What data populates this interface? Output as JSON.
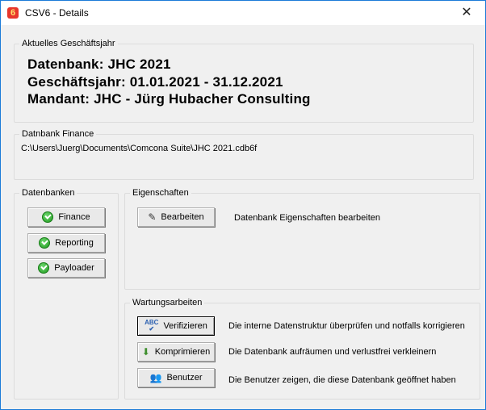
{
  "window": {
    "app_icon": "6",
    "title": "CSV6 - Details",
    "close_glyph": "✕"
  },
  "current_year": {
    "legend": "Aktuelles Geschäftsjahr",
    "database_line": "Datenbank: JHC 2021",
    "year_line": "Geschäftsjahr: 01.01.2021 - 31.12.2021",
    "client_line": "Mandant: JHC - Jürg Hubacher Consulting"
  },
  "finance_db": {
    "legend": "Datnbank Finance",
    "path": "C:\\Users\\Juerg\\Documents\\Comcona Suite\\JHC 2021.cdb6f"
  },
  "databases": {
    "legend": "Datenbanken",
    "buttons": [
      {
        "label": "Finance",
        "icon": "check-icon"
      },
      {
        "label": "Reporting",
        "icon": "check-icon"
      },
      {
        "label": "Payloader",
        "icon": "check-icon"
      }
    ]
  },
  "properties": {
    "legend": "Eigenschaften",
    "edit_button": {
      "label": "Bearbeiten",
      "icon": "edit-icon"
    },
    "edit_description": "Datenbank Eigenschaften bearbeiten"
  },
  "maintenance": {
    "legend": "Wartungsarbeiten",
    "verify_button": {
      "label": "Verifizieren",
      "icon": "spellcheck-icon"
    },
    "verify_description": "Die interne Datenstruktur überprüfen und notfalls korrigieren",
    "compress_button": {
      "label": "Komprimieren",
      "icon": "down-arrow-icon"
    },
    "compress_description": "Die Datenbank aufräumen und verlustfrei verkleinern",
    "users_button": {
      "label": "Benutzer",
      "icon": "users-icon"
    },
    "users_description": "Die Benutzer zeigen, die diese Datenbank geöffnet haben"
  }
}
